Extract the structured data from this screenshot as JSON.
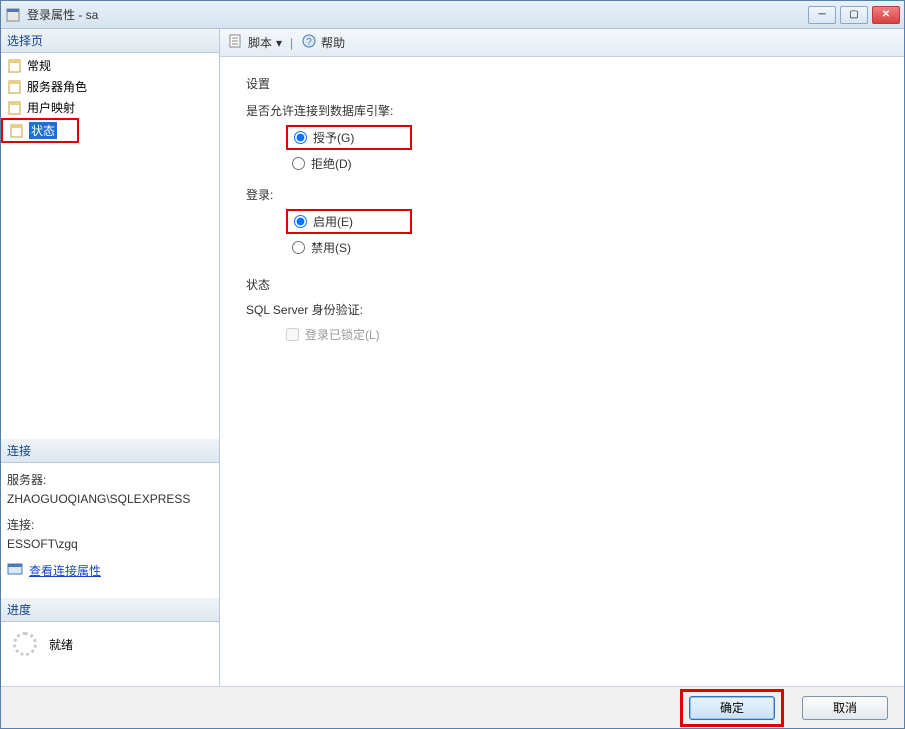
{
  "window": {
    "title": "登录属性 - sa"
  },
  "left": {
    "pages_header": "选择页",
    "pages": [
      {
        "label": "常规"
      },
      {
        "label": "服务器角色"
      },
      {
        "label": "用户映射"
      },
      {
        "label": "状态",
        "selected": true
      }
    ],
    "connection_header": "连接",
    "server_label": "服务器:",
    "server_value": "ZHAOGUOQIANG\\SQLEXPRESS",
    "conn_label": "连接:",
    "conn_value": "ESSOFT\\zgq",
    "view_props_link": "查看连接属性",
    "progress_header": "进度",
    "progress_value": "就绪"
  },
  "toolbar": {
    "script_label": "脚本",
    "help_label": "帮助"
  },
  "settings": {
    "heading": "设置",
    "connect_q": "是否允许连接到数据库引擎:",
    "grant": "授予(G)",
    "deny": "拒绝(D)",
    "login_heading": "登录:",
    "enable": "启用(E)",
    "disable": "禁用(S)",
    "status_heading": "状态",
    "sql_auth": "SQL Server 身份验证:",
    "locked": "登录已锁定(L)"
  },
  "buttons": {
    "ok": "确定",
    "cancel": "取消"
  }
}
